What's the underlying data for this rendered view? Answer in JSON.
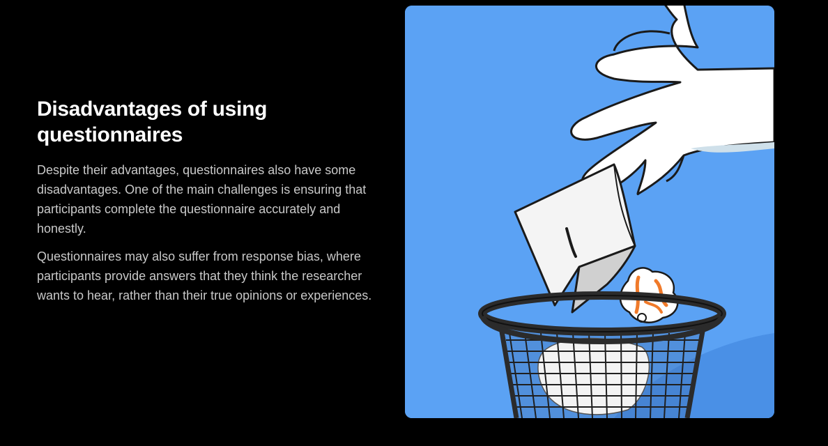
{
  "section": {
    "heading": "Disadvantages of using questionnaires",
    "paragraphs": [
      "Despite their advantages, questionnaires also have some disadvantages. One of the main challenges is ensuring that participants complete the questionnaire accurately and honestly.",
      "Questionnaires may also suffer from response bias, where participants provide answers that they think the researcher wants to hear, rather than their true opinions or experiences."
    ]
  },
  "illustration": {
    "subject": "hand-dropping-paper-into-wastebasket",
    "colors": {
      "background": "#5ba2f4",
      "page_background": "#000000",
      "basket": "#2b2b2b",
      "accent": "#f07a2a"
    }
  }
}
